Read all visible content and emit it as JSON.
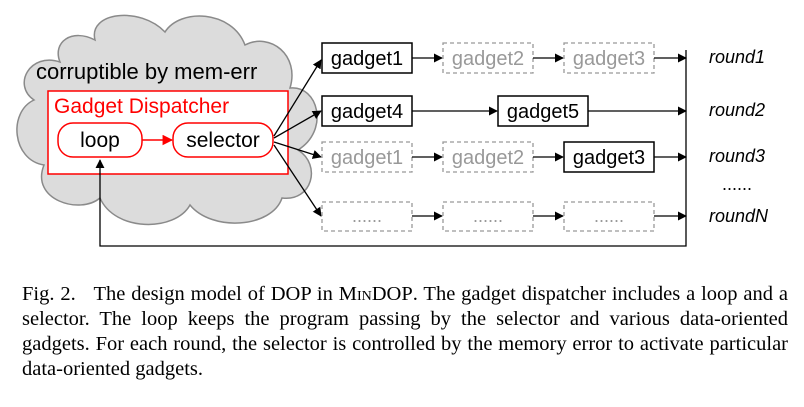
{
  "diagram": {
    "cloud_label": "corruptible by mem-err",
    "dispatcher_label": "Gadget Dispatcher",
    "loop_label": "loop",
    "selector_label": "selector",
    "colors": {
      "dispatcher": "#ff0000",
      "inactive": "#999999",
      "active": "#000000",
      "cloud_fill": "#dcdcdc"
    },
    "rows": [
      {
        "round": "round1",
        "gadgets": [
          {
            "label": "gadget1",
            "active": true
          },
          {
            "label": "gadget2",
            "active": false
          },
          {
            "label": "gadget3",
            "active": false
          }
        ]
      },
      {
        "round": "round2",
        "gadgets": [
          {
            "label": "gadget4",
            "active": true
          },
          {
            "label": "gadget5",
            "active": true
          }
        ]
      },
      {
        "round": "round3",
        "gadgets": [
          {
            "label": "gadget1",
            "active": false
          },
          {
            "label": "gadget2",
            "active": false
          },
          {
            "label": "gadget3",
            "active": true
          }
        ]
      },
      {
        "round": "roundN",
        "gadgets": [
          {
            "label": "......",
            "active": false
          },
          {
            "label": "......",
            "active": false
          },
          {
            "label": "......",
            "active": false
          }
        ]
      }
    ],
    "ellipsis_label": "......"
  },
  "caption": {
    "prefix": "Fig. 2.",
    "text_before": "The design model of DOP in ",
    "system_name": "MinDOP",
    "text_after": ". The gadget dispatcher includes a loop and a selector. The loop keeps the program passing by the selector and various data-oriented gadgets. For each round, the selector is controlled by the memory error to activate particular data-oriented gadgets."
  }
}
